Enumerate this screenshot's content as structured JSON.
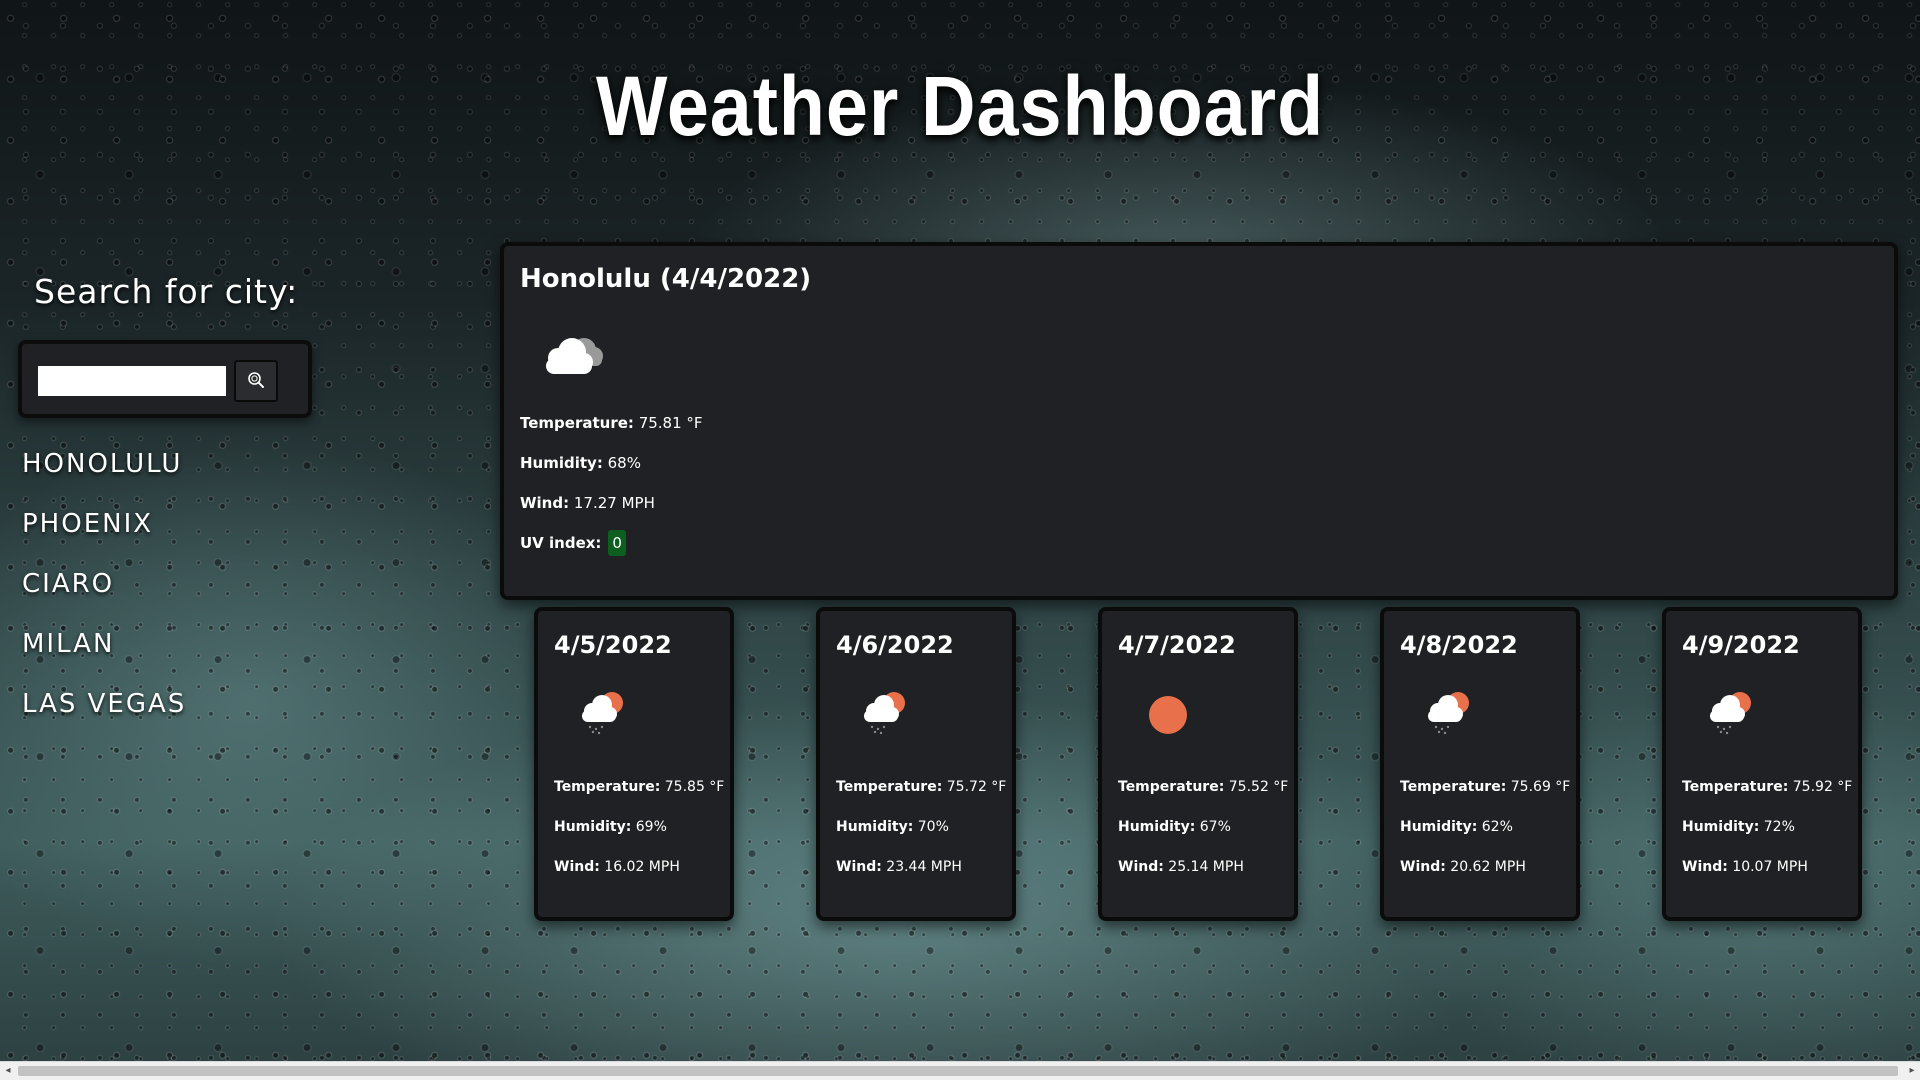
{
  "header": {
    "title": "Weather Dashboard"
  },
  "search": {
    "label": "Search for city:",
    "input_value": "",
    "placeholder": "",
    "button_icon": "search-icon"
  },
  "history": {
    "cities": [
      "HONOLULU",
      "PHOENIX",
      "CIARO",
      "MILAN",
      "LAS VEGAS"
    ]
  },
  "current": {
    "title": "Honolulu (4/4/2022)",
    "icon": "cloudy-icon",
    "temperature_label": "Temperature:",
    "temperature_value": "75.81 °F",
    "humidity_label": "Humidity:",
    "humidity_value": "68%",
    "wind_label": "Wind:",
    "wind_value": "17.27 MPH",
    "uv_label": "UV index:",
    "uv_value": "0",
    "uv_color": "#0d5f1f"
  },
  "forecast": {
    "temperature_label": "Temperature:",
    "humidity_label": "Humidity:",
    "wind_label": "Wind:",
    "days": [
      {
        "date": "4/5/2022",
        "icon": "sun-rain-cloud-icon",
        "temperature": "75.85 °F",
        "humidity": "69%",
        "wind": "16.02 MPH"
      },
      {
        "date": "4/6/2022",
        "icon": "sun-rain-cloud-icon",
        "temperature": "75.72 °F",
        "humidity": "70%",
        "wind": "23.44 MPH"
      },
      {
        "date": "4/7/2022",
        "icon": "sun-icon",
        "temperature": "75.52 °F",
        "humidity": "67%",
        "wind": "25.14 MPH"
      },
      {
        "date": "4/8/2022",
        "icon": "sun-rain-cloud-icon",
        "temperature": "75.69 °F",
        "humidity": "62%",
        "wind": "20.62 MPH"
      },
      {
        "date": "4/9/2022",
        "icon": "sun-rain-cloud-icon",
        "temperature": "75.92 °F",
        "humidity": "72%",
        "wind": "10.07 MPH"
      }
    ]
  },
  "colors": {
    "card_bg": "#202124",
    "sun": "#e8704a",
    "cloud": "#ffffff"
  }
}
